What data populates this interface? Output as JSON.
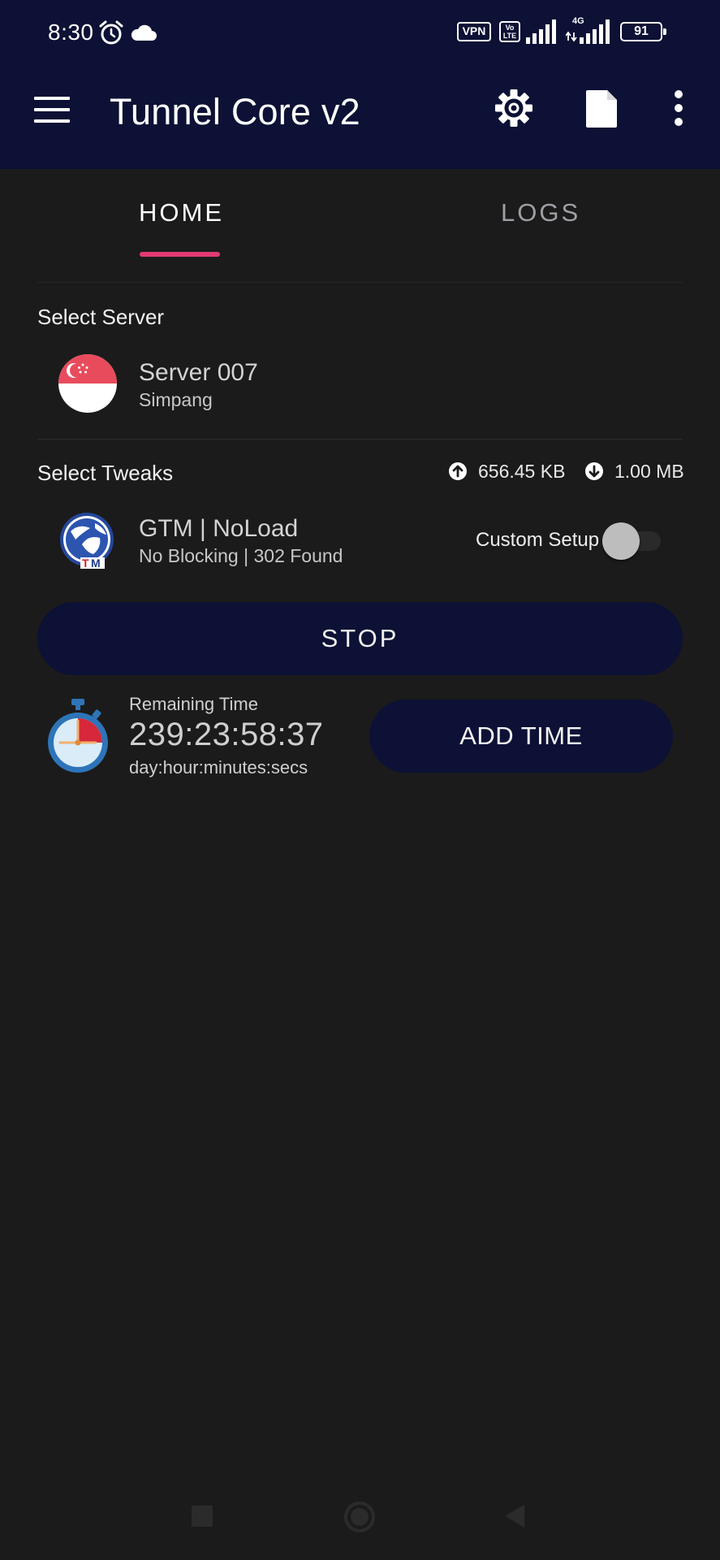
{
  "status_bar": {
    "time": "8:30",
    "vpn": "VPN",
    "volte_top": "Vo",
    "volte_bottom": "LTE",
    "network": "4G",
    "battery": "91"
  },
  "app_bar": {
    "title": "Tunnel Core v2",
    "icons": [
      "menu-icon",
      "gear-icon",
      "document-icon",
      "more-vert-icon"
    ]
  },
  "tabs": [
    {
      "label": "HOME",
      "selected": true
    },
    {
      "label": "LOGS",
      "selected": false
    }
  ],
  "server": {
    "section_label": "Select Server",
    "name": "Server 007",
    "subtitle": "Simpang"
  },
  "tweaks": {
    "section_label": "Select Tweaks",
    "upload": "656.45 KB",
    "download": "1.00 MB",
    "name": "GTM | NoLoad",
    "subtitle": "No Blocking | 302 Found",
    "custom_setup_label": "Custom Setup",
    "custom_setup_on": false
  },
  "actions": {
    "stop_label": "STOP",
    "add_time_label": "ADD TIME"
  },
  "timer": {
    "label": "Remaining Time",
    "value": "239:23:58:37",
    "format": "day:hour:minutes:secs"
  },
  "colors": {
    "header_bg": "#0c1135",
    "body_bg": "#1b1b1b",
    "accent": "#e23a73",
    "button_bg": "#0c1135"
  }
}
